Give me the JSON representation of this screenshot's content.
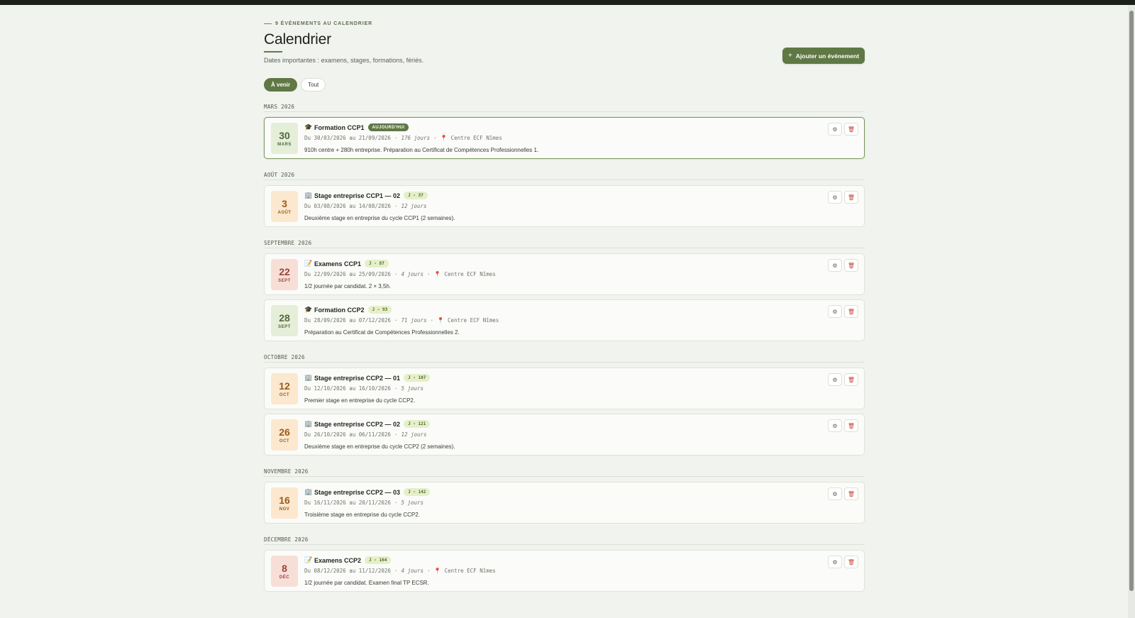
{
  "header": {
    "eyebrow": "9 ÉVÉNEMENTS AU CALENDRIER",
    "title": "Calendrier",
    "subtitle": "Dates importantes : examens, stages, formations, fériés.",
    "add_icon": "+",
    "add_label": "Ajouter un événement"
  },
  "filters": [
    {
      "label": "À venir",
      "active": true
    },
    {
      "label": "Tout",
      "active": false
    }
  ],
  "icons": {
    "pin": "📍",
    "gear": "⚙",
    "trash": "🗑",
    "add": "plus-icon"
  },
  "colors": {
    "accent": "#5f7844",
    "danger": "#c44a3a"
  },
  "months": [
    {
      "label": "MARS 2026",
      "events": [
        {
          "day": "30",
          "mon": "MARS",
          "tone": "green",
          "icon": "🎓",
          "title": "Formation CCP1",
          "badge": "AUJOURD'HUI",
          "badge_type": "today",
          "range": "Du 30/03/2026 au 21/09/2026",
          "duration": "176 jours",
          "location": "Centre ECF Nîmes",
          "desc": "910h centre + 280h entreprise. Préparation au Certificat de Compétences Professionnelles 1."
        }
      ]
    },
    {
      "label": "AOÛT 2026",
      "events": [
        {
          "day": "3",
          "mon": "AOÛT",
          "tone": "orange",
          "icon": "🏢",
          "title": "Stage entreprise CCP1 — 02",
          "badge": "J - 37",
          "badge_type": "j",
          "range": "Du 03/08/2026 au 14/08/2026",
          "duration": "12 jours",
          "location": "",
          "desc": "Deuxième stage en entreprise du cycle CCP1 (2 semaines)."
        }
      ]
    },
    {
      "label": "SEPTEMBRE 2026",
      "events": [
        {
          "day": "22",
          "mon": "SEPT",
          "tone": "red",
          "icon": "📝",
          "title": "Examens CCP1",
          "badge": "J - 87",
          "badge_type": "j",
          "range": "Du 22/09/2026 au 25/09/2026",
          "duration": "4 jours",
          "location": "Centre ECF Nîmes",
          "desc": "1/2 journée par candidat. 2 × 3,5h."
        },
        {
          "day": "28",
          "mon": "SEPT",
          "tone": "green",
          "icon": "🎓",
          "title": "Formation CCP2",
          "badge": "J - 93",
          "badge_type": "j",
          "range": "Du 28/09/2026 au 07/12/2026",
          "duration": "71 jours",
          "location": "Centre ECF Nîmes",
          "desc": "Préparation au Certificat de Compétences Professionnelles 2."
        }
      ]
    },
    {
      "label": "OCTOBRE 2026",
      "events": [
        {
          "day": "12",
          "mon": "OCT",
          "tone": "orange",
          "icon": "🏢",
          "title": "Stage entreprise CCP2 — 01",
          "badge": "J - 107",
          "badge_type": "j",
          "range": "Du 12/10/2026 au 16/10/2026",
          "duration": "5 jours",
          "location": "",
          "desc": "Premier stage en entreprise du cycle CCP2."
        },
        {
          "day": "26",
          "mon": "OCT",
          "tone": "orange",
          "icon": "🏢",
          "title": "Stage entreprise CCP2 — 02",
          "badge": "J - 121",
          "badge_type": "j",
          "range": "Du 26/10/2026 au 06/11/2026",
          "duration": "12 jours",
          "location": "",
          "desc": "Deuxième stage en entreprise du cycle CCP2 (2 semaines)."
        }
      ]
    },
    {
      "label": "NOVEMBRE 2026",
      "events": [
        {
          "day": "16",
          "mon": "NOV",
          "tone": "orange",
          "icon": "🏢",
          "title": "Stage entreprise CCP2 — 03",
          "badge": "J - 142",
          "badge_type": "j",
          "range": "Du 16/11/2026 au 20/11/2026",
          "duration": "5 jours",
          "location": "",
          "desc": "Troisième stage en entreprise du cycle CCP2."
        }
      ]
    },
    {
      "label": "DÉCEMBRE 2026",
      "events": [
        {
          "day": "8",
          "mon": "DÉC",
          "tone": "red",
          "icon": "📝",
          "title": "Examens CCP2",
          "badge": "J - 164",
          "badge_type": "j",
          "range": "Du 08/12/2026 au 11/12/2026",
          "duration": "4 jours",
          "location": "Centre ECF Nîmes",
          "desc": "1/2 journée par candidat. Examen final TP ECSR."
        }
      ]
    }
  ]
}
